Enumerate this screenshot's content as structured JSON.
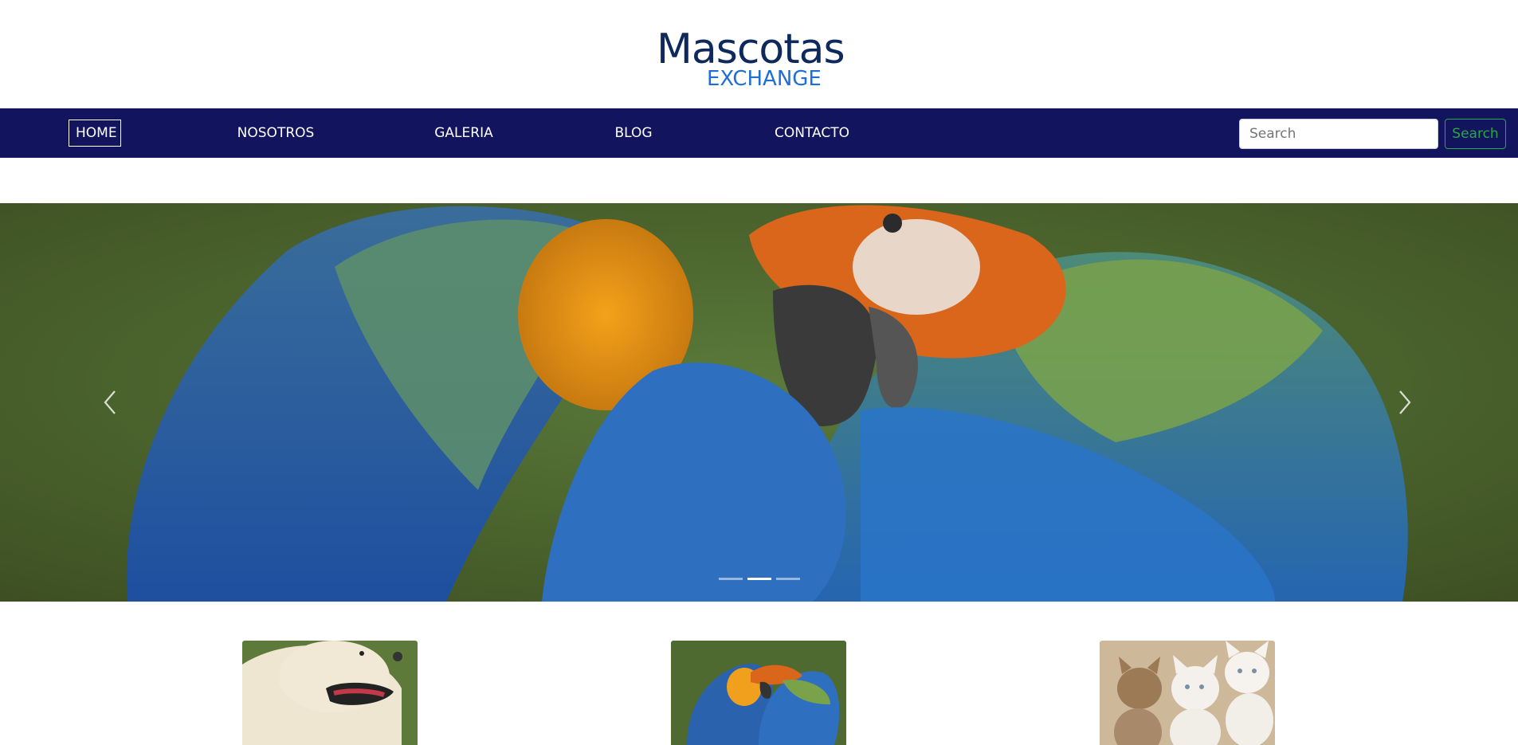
{
  "brand": {
    "logo_main": "Mascotas",
    "logo_sub": "EXCHANGE",
    "colors": {
      "primary": "#0e2a5c",
      "accent": "#1d6fd6"
    }
  },
  "navbar": {
    "background": "#12145e",
    "items": [
      {
        "label": "HOME",
        "active": true
      },
      {
        "label": "NOSOTROS",
        "active": false
      },
      {
        "label": "GALERIA",
        "active": false
      },
      {
        "label": "BLOG",
        "active": false
      },
      {
        "label": "CONTACTO",
        "active": false
      }
    ],
    "search": {
      "placeholder": "Search",
      "button_label": "Search",
      "button_color": "#28a745"
    }
  },
  "carousel": {
    "slide_subject": "macaw-parrots",
    "prev_icon": "chevron-left-icon",
    "next_icon": "chevron-right-icon",
    "indicator_count": 3,
    "active_indicator": 1
  },
  "thumbnails": [
    {
      "subject": "dog"
    },
    {
      "subject": "parrots"
    },
    {
      "subject": "kittens"
    }
  ]
}
